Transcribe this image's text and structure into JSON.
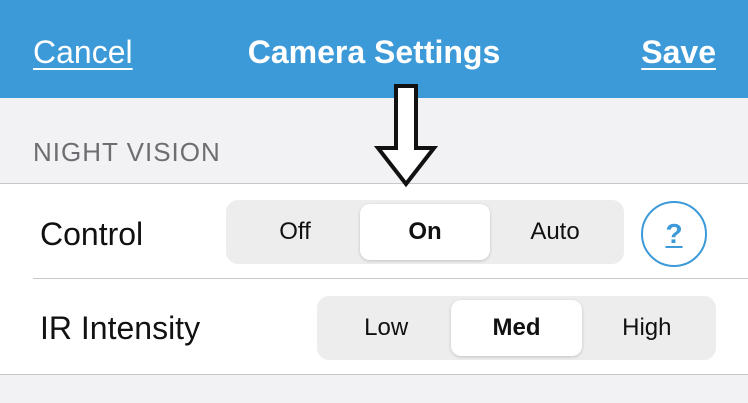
{
  "navbar": {
    "cancel_label": "Cancel",
    "title": "Camera Settings",
    "save_label": "Save",
    "color": "#3d9ad8"
  },
  "section": {
    "header": "NIGHT VISION"
  },
  "control": {
    "label": "Control",
    "options": [
      "Off",
      "On",
      "Auto"
    ],
    "selected": "On",
    "help_label": "?",
    "help_icon": "question-mark-icon"
  },
  "ir_intensity": {
    "label": "IR Intensity",
    "options": [
      "Low",
      "Med",
      "High"
    ],
    "selected": "Med"
  },
  "annotation": {
    "icon": "down-arrow-icon"
  }
}
